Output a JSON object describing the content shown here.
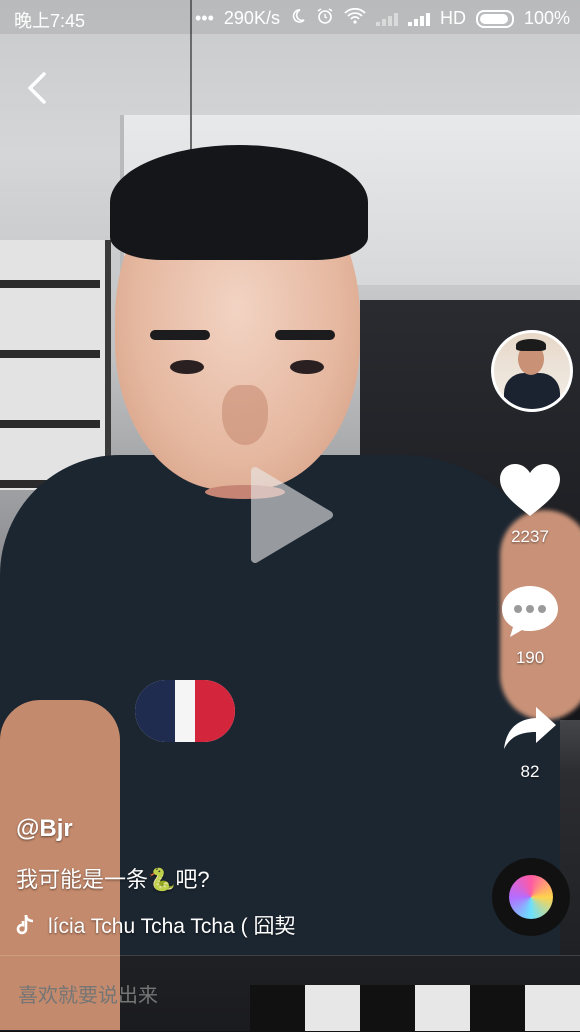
{
  "status_bar": {
    "time": "晚上7:45",
    "dots": "•••",
    "speed": "290K/s",
    "network_type": "HD",
    "battery": "100%"
  },
  "icons": {
    "back": "chevron-left-icon",
    "play": "play-icon",
    "like": "heart-icon",
    "comment": "chat-bubble-icon",
    "share": "share-arrow-icon",
    "music": "tiktok-note-icon",
    "moon": "moon-icon",
    "alarm": "alarm-icon",
    "wifi": "wifi-icon"
  },
  "actions": {
    "likes": "2237",
    "comments": "190",
    "shares": "82"
  },
  "post": {
    "username": "@Bjr",
    "caption": "我可能是一条🐍吧?",
    "music": "lícia Tchu Tcha Tcha ( 囧契"
  },
  "comment_bar": {
    "placeholder": "喜欢就要说出来"
  },
  "colors": {
    "text": "#ffffff",
    "shirt": "#1c2631"
  }
}
